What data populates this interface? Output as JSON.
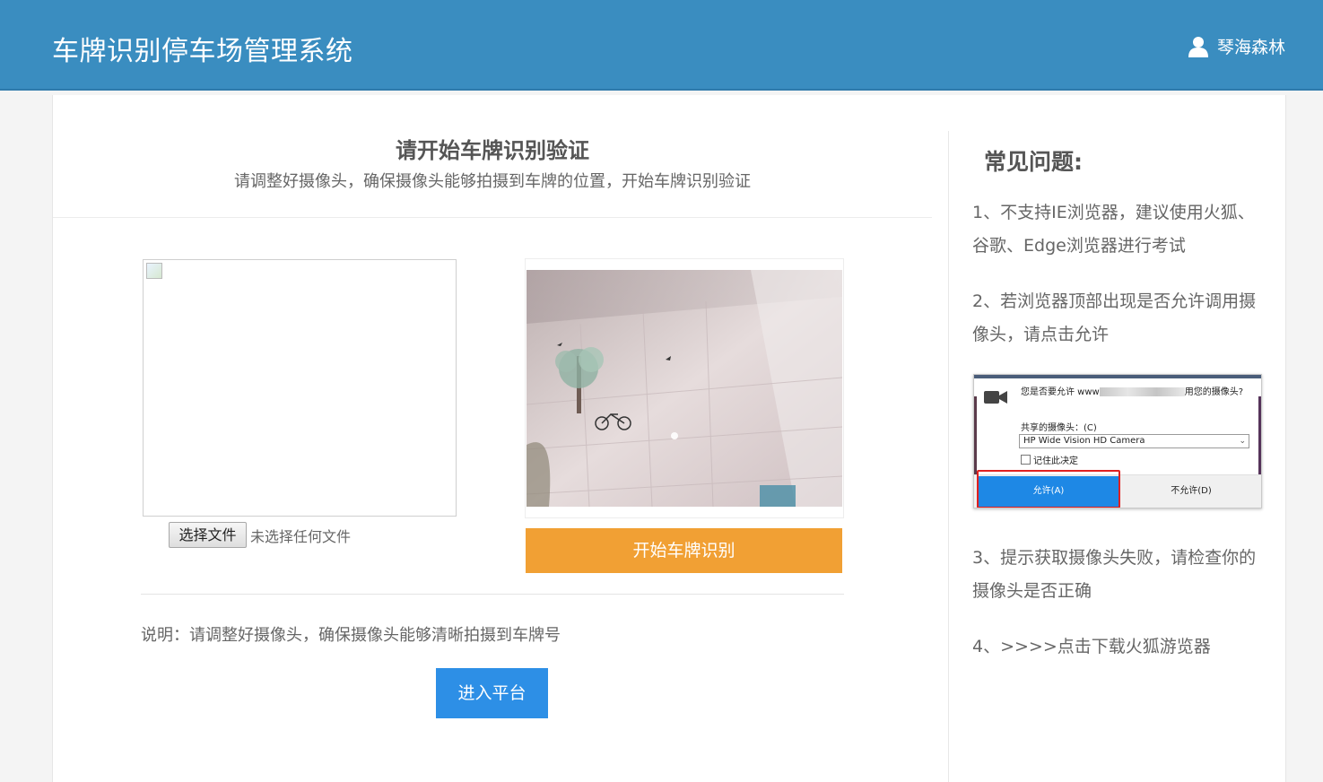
{
  "header": {
    "title": "车牌识别停车场管理系统",
    "user_name": "琴海森林"
  },
  "verify": {
    "title": "请开始车牌识别验证",
    "subtitle": "请调整好摄像头，确保摄像头能够拍摄到车牌的位置，开始车牌识别验证"
  },
  "upload": {
    "file_button": "选择文件",
    "file_status": "未选择任何文件"
  },
  "camera": {
    "start_button": "开始车牌识别"
  },
  "note": "说明：请调整好摄像头，确保摄像头能够清晰拍摄到车牌号",
  "enter_button": "进入平台",
  "faq": {
    "title": "常见问题:",
    "items": [
      "1、不支持IE浏览器，建议使用火狐、谷歌、Edge浏览器进行考试",
      "2、若浏览器顶部出现是否允许调用摄像头，请点击允许",
      "3、提示获取摄像头失败，请检查你的摄像头是否正确",
      "4、>>>>点击下载火狐游览器"
    ]
  },
  "permission_dialog": {
    "message_prefix": "您是否要允许 www",
    "message_suffix": "用您的摄像头?",
    "shared_camera_label": "共享的摄像头：(C)",
    "camera_option": "HP Wide Vision HD Camera",
    "remember_label": "记住此决定",
    "allow_label": "允许(A)",
    "deny_label": "不允许(D)"
  }
}
